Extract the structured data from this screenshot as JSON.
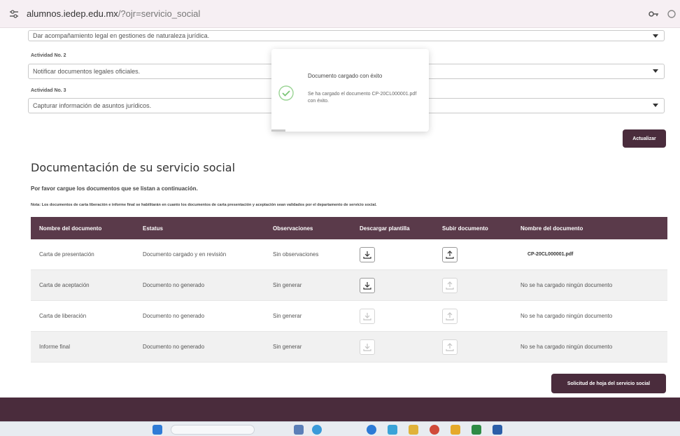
{
  "browser": {
    "url_host": "alumnos.iedep.edu.mx",
    "url_path": "/?ojr=servicio_social"
  },
  "activities": {
    "top_partial_value": "Dar acompañamiento legal en gestiones de naturaleza jurídica.",
    "items": [
      {
        "label": "Actividad No. 2",
        "value": "Notificar documentos legales oficiales."
      },
      {
        "label": "Actividad No. 3",
        "value": "Capturar información de asuntos jurídicos."
      }
    ],
    "update_button": "Actualizar"
  },
  "toast": {
    "title": "Documento cargado con éxito",
    "body": "Se ha cargado el documento CP-20CL000001.pdf con éxito."
  },
  "docs": {
    "title": "Documentación de su servicio social",
    "subtitle": "Por favor cargue los documentos que se listan a continuación.",
    "note": "Nota: Los documentos de carta liberación e informe final se habilitarán en cuanto los documentos de carta presentación y aceptación sean validados por el departamento de servicio social.",
    "headers": [
      "Nombre del documento",
      "Estatus",
      "Observaciones",
      "Descargar plantilla",
      "Subir documento",
      "Nombre del documento"
    ],
    "rows": [
      {
        "name": "Carta de presentación",
        "status": "Documento cargado y en revisión",
        "obs": "Sin observaciones",
        "file": "CP-20CL000001.pdf",
        "download_enabled": true,
        "upload_enabled": true
      },
      {
        "name": "Carta de aceptación",
        "status": "Documento no generado",
        "obs": "Sin generar",
        "file": "No se ha cargado ningún documento",
        "download_enabled": true,
        "upload_enabled": false
      },
      {
        "name": "Carta de liberación",
        "status": "Documento no generado",
        "obs": "Sin generar",
        "file": "No se ha cargado ningún documento",
        "download_enabled": false,
        "upload_enabled": false
      },
      {
        "name": "Informe final",
        "status": "Documento no generado",
        "obs": "Sin generar",
        "file": "No se ha cargado ningún documento",
        "download_enabled": false,
        "upload_enabled": false
      }
    ],
    "request_button": "Solicitud de hoja del servicio social"
  },
  "colors": {
    "brand": "#4a2c3c",
    "header_bg": "#5a3a4a",
    "success": "#7cc576"
  },
  "icons": [
    "site-settings-icon",
    "key-icon",
    "success-check-icon",
    "download-icon",
    "upload-icon",
    "windows-start-icon"
  ]
}
